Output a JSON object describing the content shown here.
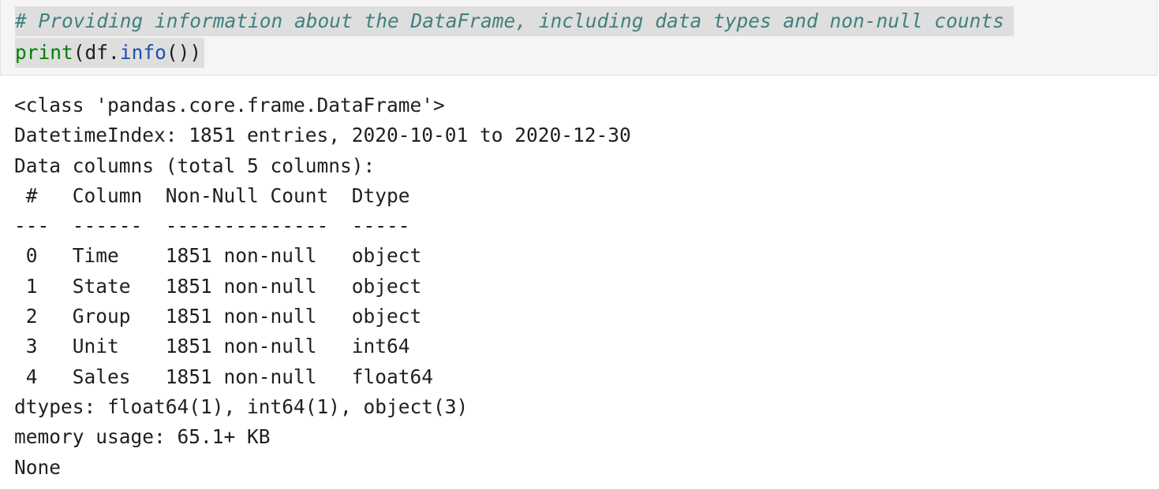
{
  "code_cell": {
    "comment": "# Providing information about the DataFrame, including data types and non-null counts",
    "code": {
      "func": "print",
      "open_paren": "(",
      "obj": "df",
      "dot": ".",
      "method": "info",
      "call_close": "())"
    }
  },
  "output": {
    "lines": [
      "<class 'pandas.core.frame.DataFrame'>",
      "DatetimeIndex: 1851 entries, 2020-10-01 to 2020-12-30",
      "Data columns (total 5 columns):",
      " #   Column  Non-Null Count  Dtype  ",
      "---  ------  --------------  -----  ",
      " 0   Time    1851 non-null   object ",
      " 1   State   1851 non-null   object ",
      " 2   Group   1851 non-null   object ",
      " 3   Unit    1851 non-null   int64  ",
      " 4   Sales   1851 non-null   float64",
      "dtypes: float64(1), int64(1), object(3)",
      "memory usage: 65.1+ KB",
      "None"
    ]
  }
}
